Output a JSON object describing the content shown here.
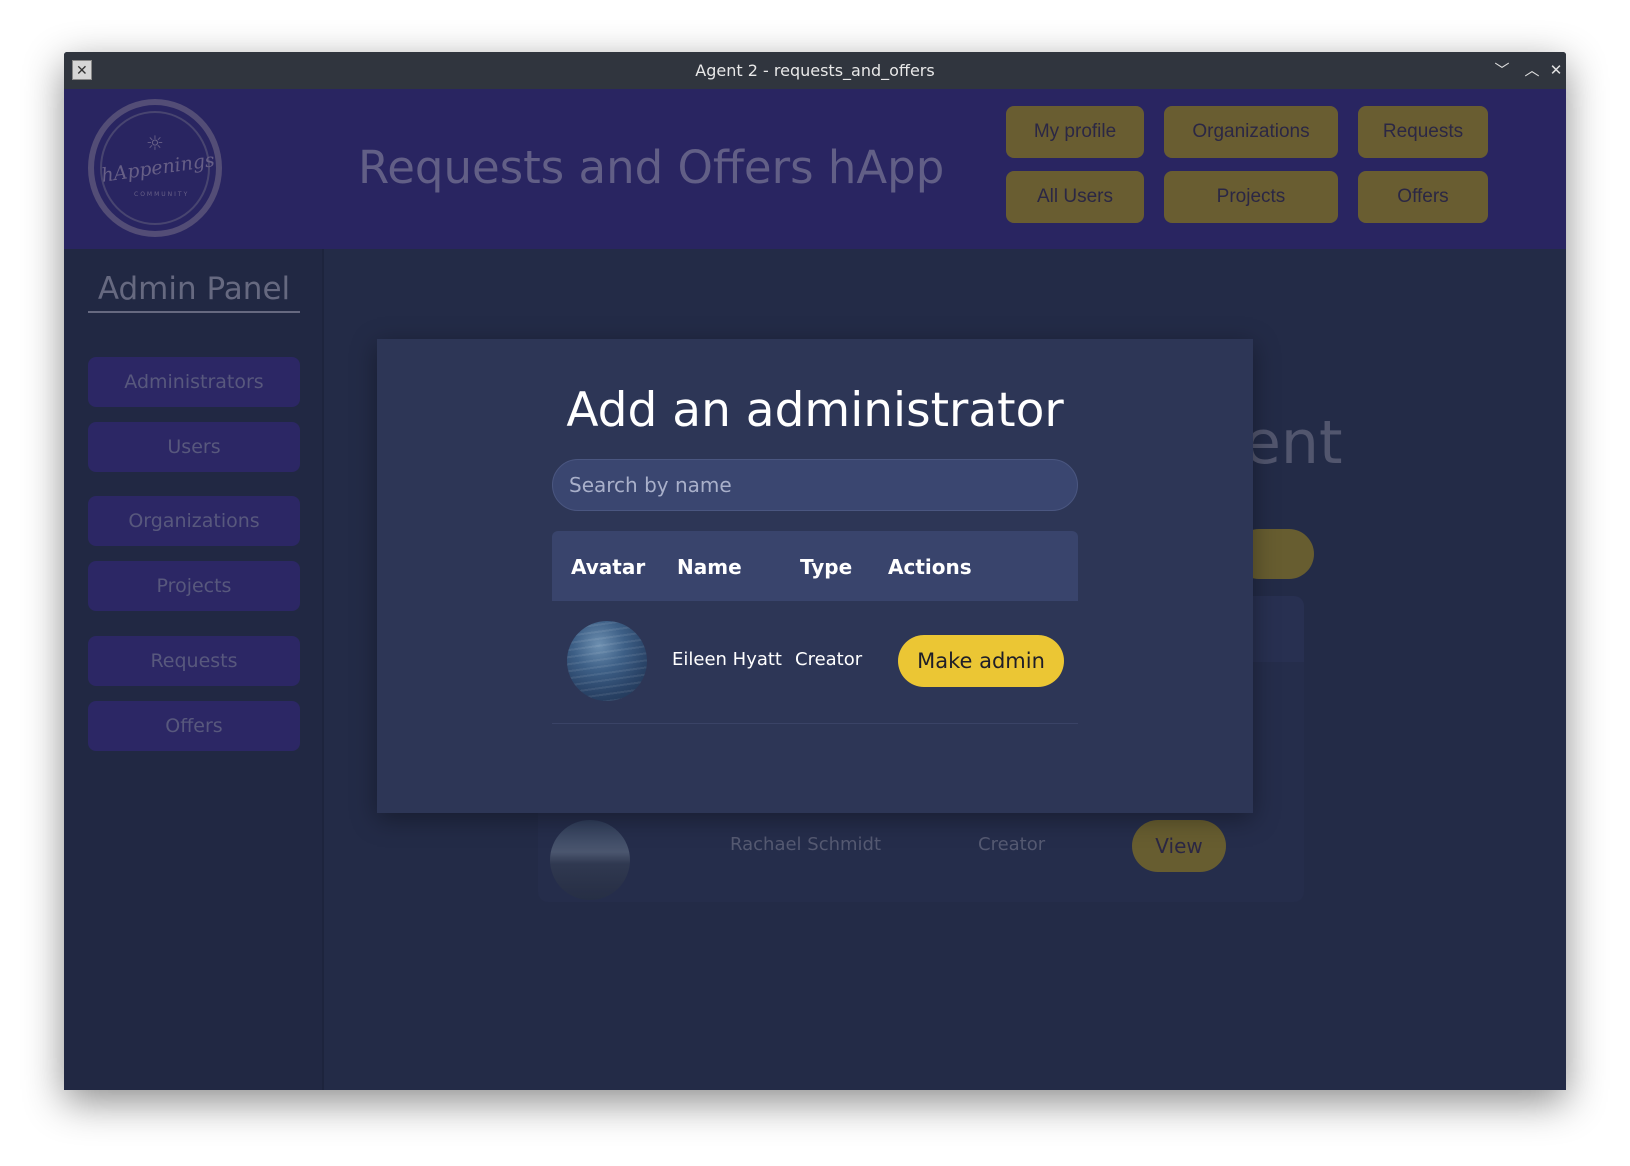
{
  "window": {
    "title": "Agent 2 - requests_and_offers"
  },
  "header": {
    "logo_text": "hAppenings",
    "logo_sub": "COMMUNITY",
    "app_title": "Requests and Offers hApp",
    "nav": [
      "My profile",
      "Organizations",
      "Requests",
      "All Users",
      "Projects",
      "Offers"
    ]
  },
  "sidebar": {
    "title": "Admin Panel",
    "items": [
      "Administrators",
      "Users",
      "Organizations",
      "Projects",
      "Requests",
      "Offers"
    ]
  },
  "background": {
    "heading_fragment": "ent",
    "row": {
      "name": "Rachael Schmidt",
      "type": "Creator",
      "action": "View"
    }
  },
  "modal": {
    "title": "Add an administrator",
    "search_placeholder": "Search by name",
    "columns": [
      "Avatar",
      "Name",
      "Type",
      "Actions"
    ],
    "rows": [
      {
        "name": "Eileen Hyatt",
        "type": "Creator",
        "action": "Make admin"
      }
    ]
  },
  "colors": {
    "accent": "#ebc634",
    "header": "#2c2868",
    "panel": "#2d3656"
  }
}
